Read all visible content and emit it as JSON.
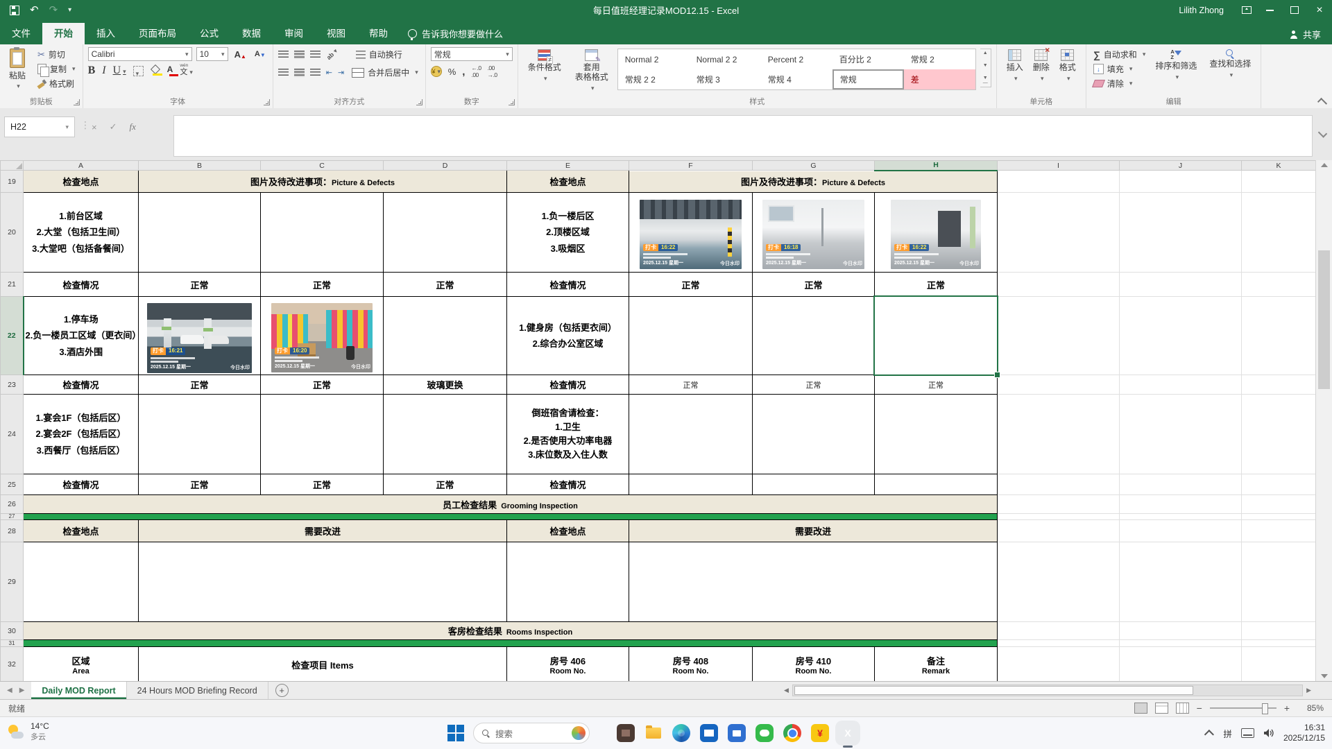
{
  "colors": {
    "excel_green": "#217346",
    "banner_beige": "#EDE8DA",
    "strip_green": "#22A24E",
    "bad_style_text": "#9C0006",
    "bad_style_fill": "#FFC7CE",
    "fill_swatch": "#FFE400",
    "font_color_swatch": "#E00000"
  },
  "titlebar": {
    "title": "每日值班经理记录MOD12.15 - Excel",
    "user": "Lilith Zhong"
  },
  "tabs": {
    "file": "文件",
    "home": "开始",
    "insert": "插入",
    "layout": "页面布局",
    "formulas": "公式",
    "data": "数据",
    "review": "审阅",
    "view": "视图",
    "help": "帮助",
    "tell_me": "告诉我你想要做什么",
    "share": "共享"
  },
  "ribbon": {
    "clipboard": {
      "label": "剪贴板",
      "paste": "粘贴",
      "cut": "剪切",
      "copy": "复制",
      "painter": "格式刷"
    },
    "font": {
      "label": "字体",
      "family": "Calibri",
      "size": "10"
    },
    "alignment": {
      "label": "对齐方式",
      "wrap": "自动换行",
      "merge": "合并后居中"
    },
    "number": {
      "label": "数字",
      "format": "常规"
    },
    "styles": {
      "label": "样式",
      "conditional": "条件格式",
      "format_table_line1": "套用",
      "format_table_line2": "表格格式",
      "gallery_row1": [
        "Normal 2",
        "Normal 2 2",
        "Percent 2",
        "百分比 2",
        "常规 2"
      ],
      "gallery_row2": [
        "常规 2 2",
        "常规 3",
        "常规 4",
        "常规",
        "差"
      ]
    },
    "cells": {
      "label": "单元格",
      "insert": "插入",
      "delete": "删除",
      "format": "格式"
    },
    "editing": {
      "label": "编辑",
      "autosum": "自动求和",
      "fill": "填充",
      "clear": "清除",
      "sort": "排序和筛选",
      "find": "查找和选择"
    }
  },
  "formula_bar": {
    "name_box": "H22"
  },
  "grid": {
    "columns": [
      "A",
      "B",
      "C",
      "D",
      "E",
      "F",
      "G",
      "H",
      "I",
      "J",
      "K"
    ],
    "rows": [
      "19",
      "20",
      "21",
      "22",
      "23",
      "24",
      "25",
      "26",
      "27",
      "28",
      "29",
      "30",
      "31",
      "32"
    ],
    "r19": {
      "a": "检查地点",
      "bd_cn": "图片及待改进事项：",
      "bd_en": "Picture & Defects",
      "e": "检查地点",
      "fh_cn": "图片及待改进事项：",
      "fh_en": "Picture & Defects"
    },
    "r20": {
      "a1": "1.前台区域",
      "a2": "2.大堂（包括卫生间）",
      "a3": "3.大堂吧（包括备餐间）",
      "e1": "1.负一楼后区",
      "e2": "2.顶楼区域",
      "e3": "3.吸烟区"
    },
    "r21": {
      "a": "检查情况",
      "b": "正常",
      "c": "正常",
      "d": "正常",
      "e": "检查情况",
      "f": "正常",
      "g": "正常",
      "h": "正常"
    },
    "r22": {
      "a1": "1.停车场",
      "a2": "2.负一楼员工区域（更衣间）",
      "a3": "3.酒店外围",
      "e1": "1.健身房（包括更衣间）",
      "e2": "2.综合办公室区域"
    },
    "r23": {
      "a": "检查情况",
      "b": "正常",
      "c": "正常",
      "d": "玻璃更换",
      "e": "检查情况",
      "f": "正常",
      "g": "正常",
      "h": "正常"
    },
    "r24": {
      "a1": "1.宴会1F（包括后区）",
      "a2": "2.宴会2F（包括后区）",
      "a3": "3.西餐厅（包括后区）",
      "e1": "倒班宿舍请检查：",
      "e2": "1.卫生",
      "e3": "2.是否使用大功率电器",
      "e4": "3.床位数及入住人数"
    },
    "r25": {
      "a": "检查情况",
      "b": "正常",
      "c": "正常",
      "d": "正常",
      "e": "检查情况"
    },
    "r26": {
      "cn": "员工检查结果",
      "en": "Grooming Inspection"
    },
    "r28": {
      "a": "检查地点",
      "bd": "需要改进",
      "e": "检查地点",
      "fh": "需要改进"
    },
    "r30": {
      "cn": "客房检查结果",
      "en": "Rooms Inspection"
    },
    "r32": {
      "a1": "区域",
      "a2": "Area",
      "bd": "检查项目 Items",
      "e1": "房号 406",
      "e2": "Room No.",
      "f1": "房号 408",
      "f2": "Room No.",
      "g1": "房号 410",
      "g2": "Room No.",
      "h1": "备注",
      "h2": "Remark"
    }
  },
  "photos": {
    "stamp": "打卡",
    "f20_time": "16:22",
    "g20_time": "16:18",
    "h20_time": "16:22",
    "b22_time": "16:21",
    "c22_time": "16:20",
    "date_line": "2025.12.15 星期一",
    "watermark": "今日水印"
  },
  "sheet_tabs": {
    "active": "Daily MOD Report",
    "second": "24 Hours MOD Briefing Record"
  },
  "status_bar": {
    "ready": "就绪",
    "zoom": "85%"
  },
  "taskbar": {
    "temp": "14°C",
    "condition": "多云",
    "search": "搜索",
    "ime": "拼",
    "time": "16:31",
    "date": "2025/12/15"
  }
}
